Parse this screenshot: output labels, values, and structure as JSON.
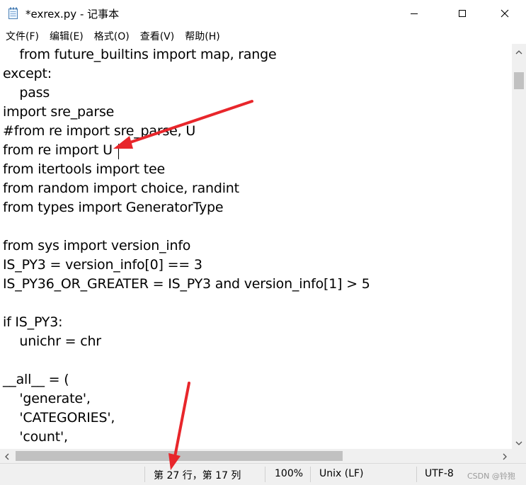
{
  "window": {
    "title": "*exrex.py - 记事本",
    "icon": "notepad-icon",
    "controls": {
      "minimize": "minimize-icon",
      "maximize": "maximize-icon",
      "close": "close-icon"
    }
  },
  "menu": {
    "items": [
      {
        "label": "文件(F)"
      },
      {
        "label": "编辑(E)"
      },
      {
        "label": "格式(O)"
      },
      {
        "label": "查看(V)"
      },
      {
        "label": "帮助(H)"
      }
    ]
  },
  "editor": {
    "lines": [
      "    from future_builtins import map, range",
      "except:",
      "    pass",
      "import sre_parse",
      "#from re import sre_parse, U",
      "from re import U",
      "from itertools import tee",
      "from random import choice, randint",
      "from types import GeneratorType",
      "",
      "from sys import version_info",
      "IS_PY3 = version_info[0] == 3",
      "IS_PY36_OR_GREATER = IS_PY3 and version_info[1] > 5",
      "",
      "if IS_PY3:",
      "    unichr = chr",
      "",
      "__all__ = (",
      "    'generate',",
      "    'CATEGORIES',",
      "    'count',"
    ]
  },
  "scrollbars": {
    "vertical": {
      "up_icon": "chevron-up-icon",
      "down_icon": "chevron-down-icon"
    },
    "horizontal": {
      "left_icon": "chevron-left-icon",
      "right_icon": "chevron-right-icon"
    }
  },
  "status": {
    "position": "第 27 行，第 17 列",
    "zoom": "100%",
    "line_ending": "Unix (LF)",
    "encoding": "UTF-8",
    "watermark": "CSDN @铃狍"
  },
  "colors": {
    "annotation_arrow": "#e8262b",
    "statusbar_bg": "#f0f0f0",
    "scroll_thumb": "#c1c1c1"
  }
}
